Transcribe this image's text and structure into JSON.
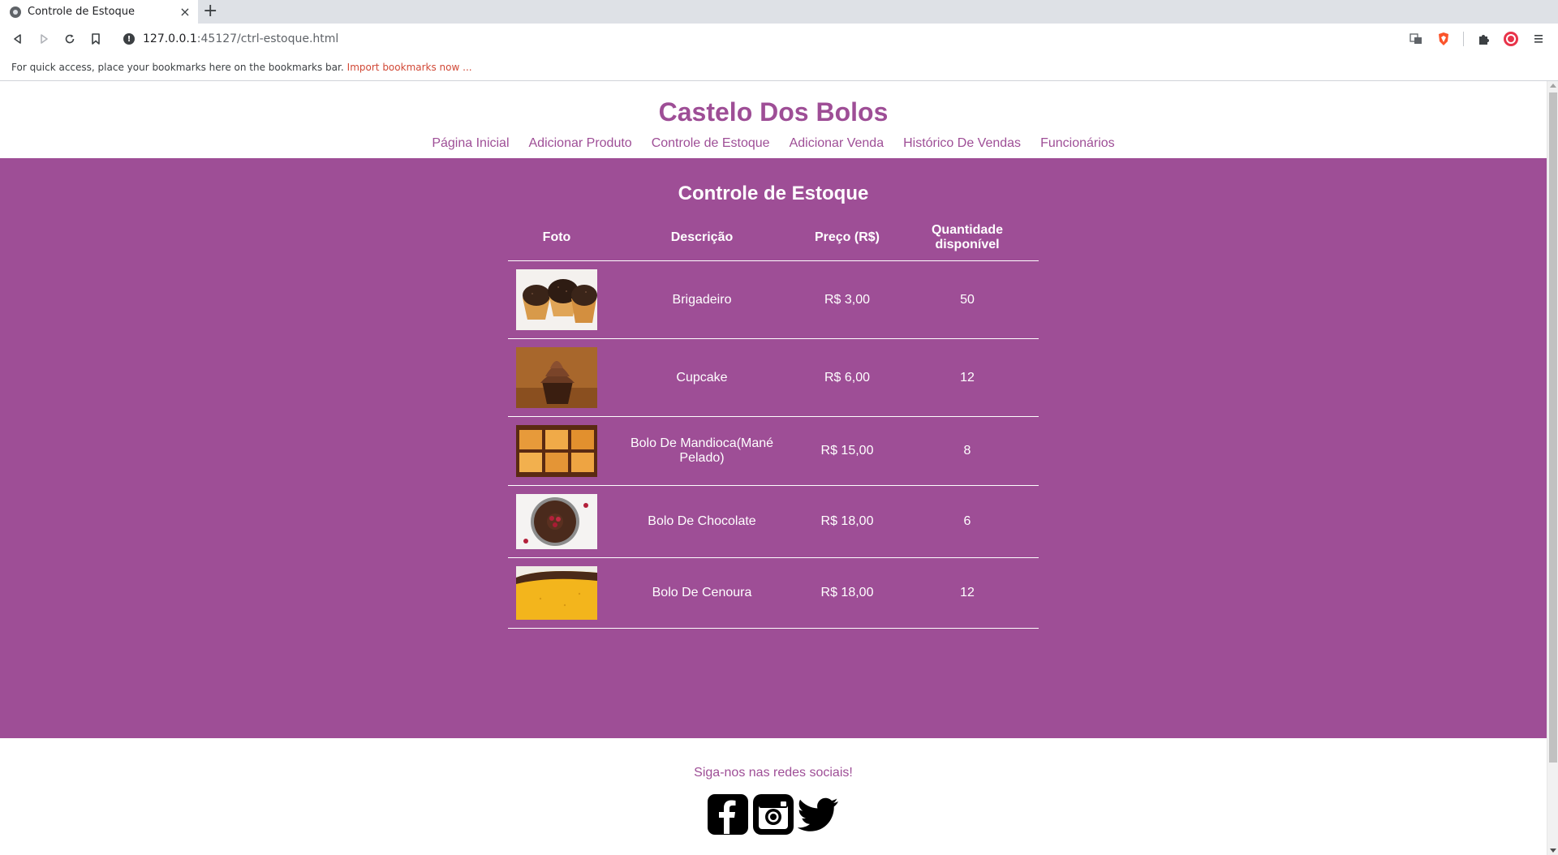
{
  "browser": {
    "tab_title": "Controle de Estoque",
    "tab_close": "×",
    "new_tab": "+",
    "url_host": "127.0.0.1",
    "url_path": ":45127/ctrl-estoque.html",
    "bookmarks_text": "For quick access, place your bookmarks here on the bookmarks bar.",
    "bookmarks_link": "Import bookmarks now ..."
  },
  "header": {
    "title": "Castelo Dos Bolos",
    "nav": [
      {
        "label": "Página Inicial"
      },
      {
        "label": "Adicionar Produto"
      },
      {
        "label": "Controle de Estoque"
      },
      {
        "label": "Adicionar Venda"
      },
      {
        "label": "Histórico De Vendas"
      },
      {
        "label": "Funcionários"
      }
    ]
  },
  "main": {
    "title": "Controle de Estoque",
    "columns": [
      "Foto",
      "Descrição",
      "Preço (R$)",
      "Quantidade disponível"
    ],
    "rows": [
      {
        "description": "Brigadeiro",
        "price": "R$ 3,00",
        "quantity": "50",
        "photo": "brigadeiro-photo"
      },
      {
        "description": "Cupcake",
        "price": "R$ 6,00",
        "quantity": "12",
        "photo": "cupcake-photo"
      },
      {
        "description": "Bolo De Mandioca(Mané Pelado)",
        "price": "R$ 15,00",
        "quantity": "8",
        "photo": "mandioca-cake-photo"
      },
      {
        "description": "Bolo De Chocolate",
        "price": "R$ 18,00",
        "quantity": "6",
        "photo": "chocolate-cake-photo"
      },
      {
        "description": "Bolo De Cenoura",
        "price": "R$ 18,00",
        "quantity": "12",
        "photo": "carrot-cake-photo"
      }
    ]
  },
  "footer": {
    "follow_text": "Siga-nos nas redes sociais!",
    "socials": [
      "facebook-icon",
      "instagram-icon",
      "twitter-icon"
    ]
  },
  "colors": {
    "brand": "#9e4e96",
    "text_light": "#ffffff"
  }
}
